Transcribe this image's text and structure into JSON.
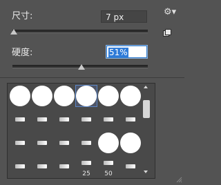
{
  "labels": {
    "size": "尺寸:",
    "hardness": "硬度:"
  },
  "inputs": {
    "size_value": "7 px",
    "hardness_value": "51%"
  },
  "sliders": {
    "size_level": 0.01,
    "hardness_level": 0.51
  },
  "icons": {
    "settings": "gear-icon",
    "new_preset": "new-brush-preset-icon",
    "scroll_up": "scroll-up-arrow-icon",
    "scroll_down": "scroll-down-arrow-icon",
    "resize": "resize-grip-icon"
  },
  "brush_presets": [
    {
      "kind": "round"
    },
    {
      "kind": "round"
    },
    {
      "kind": "round"
    },
    {
      "kind": "round",
      "selected": true
    },
    {
      "kind": "round"
    },
    {
      "kind": "round"
    },
    {
      "kind": "tip"
    },
    {
      "kind": "tip"
    },
    {
      "kind": "tip"
    },
    {
      "kind": "tip"
    },
    {
      "kind": "tip"
    },
    {
      "kind": "tip"
    },
    {
      "kind": "tip"
    },
    {
      "kind": "tip"
    },
    {
      "kind": "tip"
    },
    {
      "kind": "tip"
    },
    {
      "kind": "round"
    },
    {
      "kind": "round"
    },
    {
      "kind": "tip"
    },
    {
      "kind": "tip"
    },
    {
      "kind": "tip"
    },
    {
      "kind": "tip",
      "number": "25"
    },
    {
      "kind": "tip",
      "number": "50"
    },
    {
      "kind": "tip"
    }
  ],
  "colors": {
    "panel_bg": "#535353",
    "selection": "#2f7bd8"
  }
}
